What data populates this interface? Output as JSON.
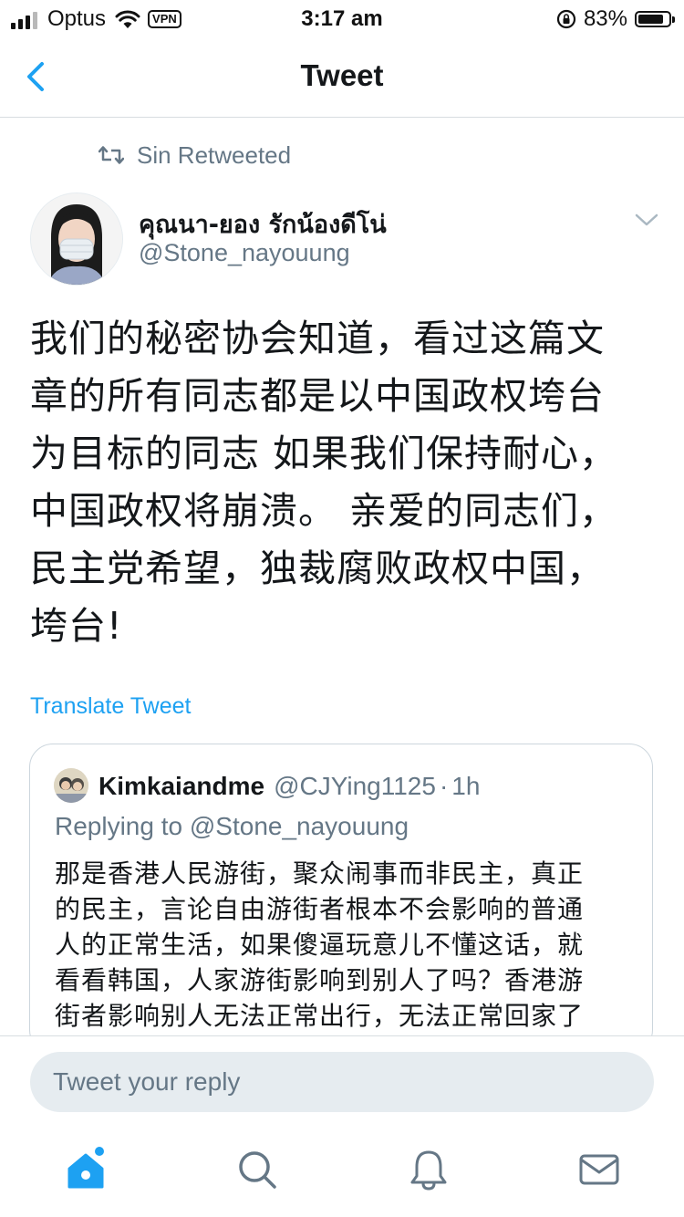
{
  "status_bar": {
    "carrier": "Optus",
    "vpn_label": "VPN",
    "time": "3:17 am",
    "battery_percent": "83%",
    "battery_level": 0.83
  },
  "nav": {
    "title": "Tweet"
  },
  "retweet": {
    "label": "Sin Retweeted"
  },
  "tweet": {
    "author_name": "คุณนา-ยอง รักน้องดีโน่",
    "author_handle": "@Stone_nayouung",
    "text_lines": [
      "我们的秘密协会知道，看过这篇文",
      "章的所有同志都是以中国政权垮台",
      "为目标的同志 如果我们保持耐心，",
      "中国政权将崩溃。 亲爱的同志们，",
      "民主党希望，独裁腐败政权中国，",
      "垮台!"
    ],
    "translate_label": "Translate Tweet"
  },
  "quoted_tweet": {
    "name": "Kimkaiandme",
    "handle": "@CJYing1125",
    "separator": "·",
    "time": "1h",
    "replying_to": "Replying to @Stone_nayouung",
    "text_lines": [
      "那是香港人民游街，聚众闹事而非民主，真正",
      "的民主，言论自由游街者根本不会影响的普通",
      "人的正常生活，如果傻逼玩意儿不懂这话，就",
      "看看韩国，人家游街影响到别人了吗？香港游",
      "街者影响别人无法正常出行，无法正常回家了"
    ]
  },
  "reply_bar": {
    "placeholder": "Tweet your reply"
  },
  "tab_bar": {
    "tabs": [
      "home-icon",
      "search-icon",
      "notifications-icon",
      "messages-icon"
    ],
    "accent_color": "#1da1f2",
    "inactive_color": "#657786"
  }
}
